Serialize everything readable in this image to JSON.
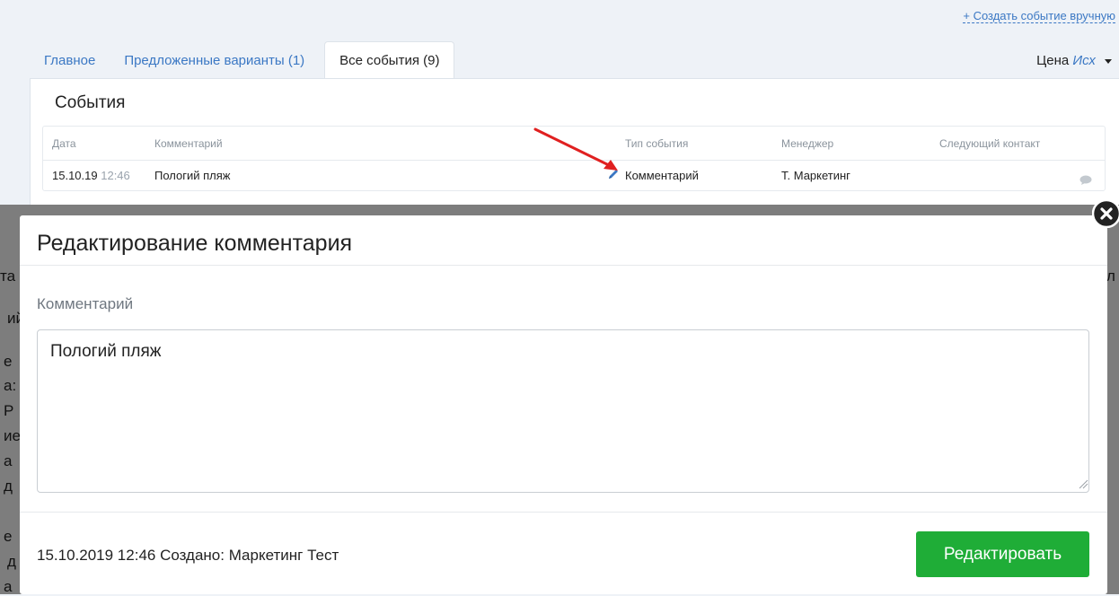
{
  "header": {
    "create_link": "+ Создать событие вручную",
    "price_label": "Цена",
    "price_currency": "Исх"
  },
  "tabs": [
    {
      "label": "Главное"
    },
    {
      "label": "Предложенные варианты (1)"
    },
    {
      "label": "Все события (9)"
    }
  ],
  "events": {
    "title": "События",
    "columns": [
      "Дата",
      "Комментарий",
      "Тип события",
      "Менеджер",
      "Следующий контакт"
    ],
    "rows": [
      {
        "date": "15.10.19",
        "time": "12:46",
        "comment": "Пологий пляж",
        "type": "Комментарий",
        "manager": "Т. Маркетинг",
        "next": ""
      }
    ]
  },
  "modal": {
    "title": "Редактирование комментария",
    "field_label": "Комментарий",
    "comment_value": "Пологий пляж",
    "footer_info": "15.10.2019 12:46 Создано: Маркетинг Тест",
    "submit_label": "Редактировать"
  },
  "colors": {
    "accent": "#3b78c4",
    "submit": "#1fad37",
    "annotation_arrow": "#e02020",
    "overlay": "#7d7d7d"
  },
  "icons": [
    "edit-pencil-icon",
    "chat-bubble-icon",
    "close-icon",
    "resize-handle-icon",
    "caret-down-icon"
  ]
}
